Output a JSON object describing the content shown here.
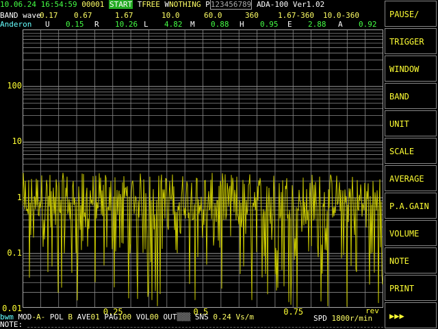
{
  "header": {
    "date": "10.06.24",
    "time": "16:54:59",
    "counter": "00001",
    "start_label": "START",
    "trigger_prefix": "T",
    "trigger_value": "FREE",
    "window_prefix": "W",
    "window_value": "NOTHING",
    "print_prefix": "P",
    "print_digits": "123456789",
    "device": "ADA-100",
    "version": "Ver1.02"
  },
  "band_row": {
    "band_label": "BAND",
    "wave_label": "wave",
    "bands": [
      "0.17",
      "0.67",
      "1.67",
      "10.0",
      "60.0",
      "360",
      "1.67-360",
      "10.0-360"
    ]
  },
  "params_row": {
    "name": "Anderon",
    "params": [
      {
        "key": "U",
        "value": "0.15"
      },
      {
        "key": "R",
        "value": "10.26"
      },
      {
        "key": "L",
        "value": "4.82"
      },
      {
        "key": "M",
        "value": "0.88"
      },
      {
        "key": "H",
        "value": "0.95"
      },
      {
        "key": "E",
        "value": "2.88"
      },
      {
        "key": "A",
        "value": "0.92"
      }
    ]
  },
  "plot": {
    "y_ticks": [
      "100",
      "10",
      "1",
      "0.1",
      "0.01"
    ],
    "x_ticks": [
      "0.25",
      "0.5",
      "0.75"
    ],
    "x_unit": "rev",
    "trace_color": "#c8c800",
    "grid_color": "#8c8c8c"
  },
  "footer": {
    "mode_tag": "bwm",
    "mod_label": "MOD",
    "mod_value": "-A-",
    "pol_label": "POL",
    "pol_value": "B",
    "ave_label": "AVE",
    "ave_value": "01",
    "pag_label": "PAG",
    "pag_value": "100",
    "vol_label": "VOL",
    "vol_value": "00",
    "out_label": "OUT",
    "sns_label": "SNS",
    "sns_value": "0.24",
    "sns_unit": "Vs/m",
    "spd_label": "SPD",
    "spd_value": "1800",
    "spd_unit": "r/min",
    "note_label": "NOTE:"
  },
  "menu": [
    "PAUSE/",
    "TRIGGER",
    "WINDOW",
    "BAND",
    "UNIT",
    "SCALE",
    "AVERAGE",
    "P.A.GAIN",
    "VOLUME",
    "NOTE",
    "PRINT",
    "▶▶▶"
  ]
}
